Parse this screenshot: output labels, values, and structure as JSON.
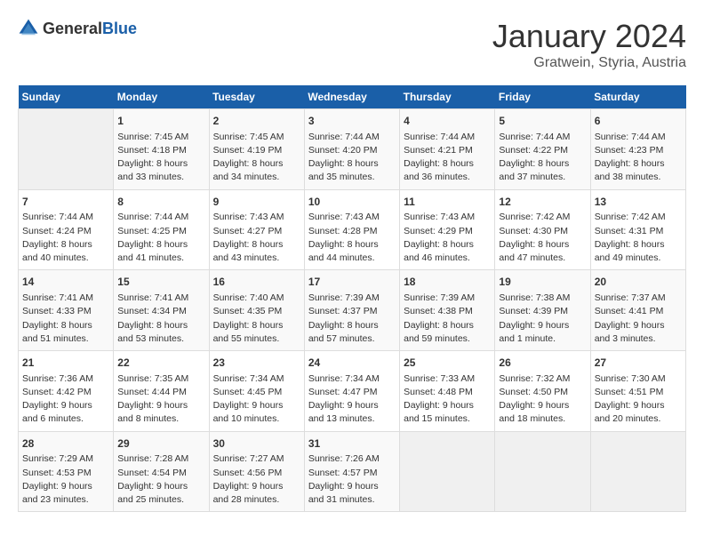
{
  "logo": {
    "text_general": "General",
    "text_blue": "Blue"
  },
  "header": {
    "month_title": "January 2024",
    "location": "Gratwein, Styria, Austria"
  },
  "weekdays": [
    "Sunday",
    "Monday",
    "Tuesday",
    "Wednesday",
    "Thursday",
    "Friday",
    "Saturday"
  ],
  "weeks": [
    [
      {
        "day": "",
        "sunrise": "",
        "sunset": "",
        "daylight": ""
      },
      {
        "day": "1",
        "sunrise": "Sunrise: 7:45 AM",
        "sunset": "Sunset: 4:18 PM",
        "daylight": "Daylight: 8 hours and 33 minutes."
      },
      {
        "day": "2",
        "sunrise": "Sunrise: 7:45 AM",
        "sunset": "Sunset: 4:19 PM",
        "daylight": "Daylight: 8 hours and 34 minutes."
      },
      {
        "day": "3",
        "sunrise": "Sunrise: 7:44 AM",
        "sunset": "Sunset: 4:20 PM",
        "daylight": "Daylight: 8 hours and 35 minutes."
      },
      {
        "day": "4",
        "sunrise": "Sunrise: 7:44 AM",
        "sunset": "Sunset: 4:21 PM",
        "daylight": "Daylight: 8 hours and 36 minutes."
      },
      {
        "day": "5",
        "sunrise": "Sunrise: 7:44 AM",
        "sunset": "Sunset: 4:22 PM",
        "daylight": "Daylight: 8 hours and 37 minutes."
      },
      {
        "day": "6",
        "sunrise": "Sunrise: 7:44 AM",
        "sunset": "Sunset: 4:23 PM",
        "daylight": "Daylight: 8 hours and 38 minutes."
      }
    ],
    [
      {
        "day": "7",
        "sunrise": "Sunrise: 7:44 AM",
        "sunset": "Sunset: 4:24 PM",
        "daylight": "Daylight: 8 hours and 40 minutes."
      },
      {
        "day": "8",
        "sunrise": "Sunrise: 7:44 AM",
        "sunset": "Sunset: 4:25 PM",
        "daylight": "Daylight: 8 hours and 41 minutes."
      },
      {
        "day": "9",
        "sunrise": "Sunrise: 7:43 AM",
        "sunset": "Sunset: 4:27 PM",
        "daylight": "Daylight: 8 hours and 43 minutes."
      },
      {
        "day": "10",
        "sunrise": "Sunrise: 7:43 AM",
        "sunset": "Sunset: 4:28 PM",
        "daylight": "Daylight: 8 hours and 44 minutes."
      },
      {
        "day": "11",
        "sunrise": "Sunrise: 7:43 AM",
        "sunset": "Sunset: 4:29 PM",
        "daylight": "Daylight: 8 hours and 46 minutes."
      },
      {
        "day": "12",
        "sunrise": "Sunrise: 7:42 AM",
        "sunset": "Sunset: 4:30 PM",
        "daylight": "Daylight: 8 hours and 47 minutes."
      },
      {
        "day": "13",
        "sunrise": "Sunrise: 7:42 AM",
        "sunset": "Sunset: 4:31 PM",
        "daylight": "Daylight: 8 hours and 49 minutes."
      }
    ],
    [
      {
        "day": "14",
        "sunrise": "Sunrise: 7:41 AM",
        "sunset": "Sunset: 4:33 PM",
        "daylight": "Daylight: 8 hours and 51 minutes."
      },
      {
        "day": "15",
        "sunrise": "Sunrise: 7:41 AM",
        "sunset": "Sunset: 4:34 PM",
        "daylight": "Daylight: 8 hours and 53 minutes."
      },
      {
        "day": "16",
        "sunrise": "Sunrise: 7:40 AM",
        "sunset": "Sunset: 4:35 PM",
        "daylight": "Daylight: 8 hours and 55 minutes."
      },
      {
        "day": "17",
        "sunrise": "Sunrise: 7:39 AM",
        "sunset": "Sunset: 4:37 PM",
        "daylight": "Daylight: 8 hours and 57 minutes."
      },
      {
        "day": "18",
        "sunrise": "Sunrise: 7:39 AM",
        "sunset": "Sunset: 4:38 PM",
        "daylight": "Daylight: 8 hours and 59 minutes."
      },
      {
        "day": "19",
        "sunrise": "Sunrise: 7:38 AM",
        "sunset": "Sunset: 4:39 PM",
        "daylight": "Daylight: 9 hours and 1 minute."
      },
      {
        "day": "20",
        "sunrise": "Sunrise: 7:37 AM",
        "sunset": "Sunset: 4:41 PM",
        "daylight": "Daylight: 9 hours and 3 minutes."
      }
    ],
    [
      {
        "day": "21",
        "sunrise": "Sunrise: 7:36 AM",
        "sunset": "Sunset: 4:42 PM",
        "daylight": "Daylight: 9 hours and 6 minutes."
      },
      {
        "day": "22",
        "sunrise": "Sunrise: 7:35 AM",
        "sunset": "Sunset: 4:44 PM",
        "daylight": "Daylight: 9 hours and 8 minutes."
      },
      {
        "day": "23",
        "sunrise": "Sunrise: 7:34 AM",
        "sunset": "Sunset: 4:45 PM",
        "daylight": "Daylight: 9 hours and 10 minutes."
      },
      {
        "day": "24",
        "sunrise": "Sunrise: 7:34 AM",
        "sunset": "Sunset: 4:47 PM",
        "daylight": "Daylight: 9 hours and 13 minutes."
      },
      {
        "day": "25",
        "sunrise": "Sunrise: 7:33 AM",
        "sunset": "Sunset: 4:48 PM",
        "daylight": "Daylight: 9 hours and 15 minutes."
      },
      {
        "day": "26",
        "sunrise": "Sunrise: 7:32 AM",
        "sunset": "Sunset: 4:50 PM",
        "daylight": "Daylight: 9 hours and 18 minutes."
      },
      {
        "day": "27",
        "sunrise": "Sunrise: 7:30 AM",
        "sunset": "Sunset: 4:51 PM",
        "daylight": "Daylight: 9 hours and 20 minutes."
      }
    ],
    [
      {
        "day": "28",
        "sunrise": "Sunrise: 7:29 AM",
        "sunset": "Sunset: 4:53 PM",
        "daylight": "Daylight: 9 hours and 23 minutes."
      },
      {
        "day": "29",
        "sunrise": "Sunrise: 7:28 AM",
        "sunset": "Sunset: 4:54 PM",
        "daylight": "Daylight: 9 hours and 25 minutes."
      },
      {
        "day": "30",
        "sunrise": "Sunrise: 7:27 AM",
        "sunset": "Sunset: 4:56 PM",
        "daylight": "Daylight: 9 hours and 28 minutes."
      },
      {
        "day": "31",
        "sunrise": "Sunrise: 7:26 AM",
        "sunset": "Sunset: 4:57 PM",
        "daylight": "Daylight: 9 hours and 31 minutes."
      },
      {
        "day": "",
        "sunrise": "",
        "sunset": "",
        "daylight": ""
      },
      {
        "day": "",
        "sunrise": "",
        "sunset": "",
        "daylight": ""
      },
      {
        "day": "",
        "sunrise": "",
        "sunset": "",
        "daylight": ""
      }
    ]
  ]
}
